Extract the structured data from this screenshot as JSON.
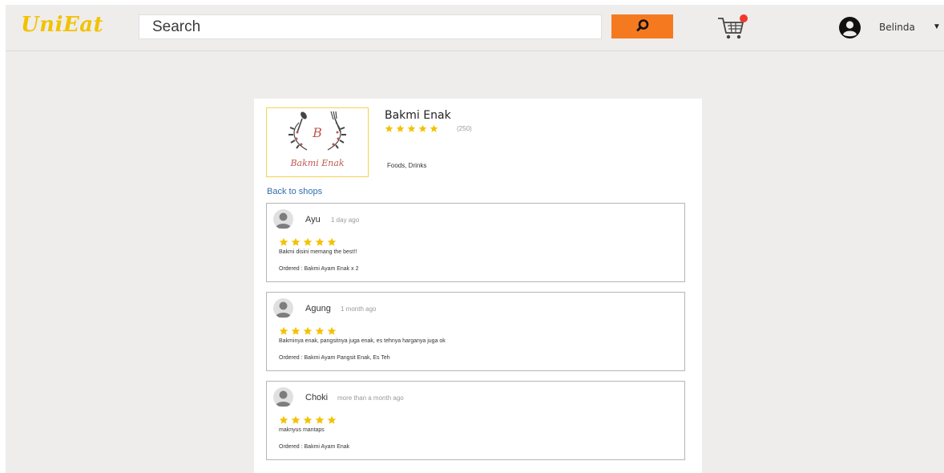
{
  "app": {
    "logo": "UniEat"
  },
  "search": {
    "placeholder": "Search"
  },
  "user": {
    "name": "Belinda"
  },
  "colors": {
    "accent": "#f57a1f",
    "logo": "#f2c200",
    "star": "#f2c200",
    "badge": "#f0382e",
    "link": "#2f6fae"
  },
  "icons": {
    "search": "search-icon",
    "cart": "cart-icon",
    "user": "user-avatar-icon",
    "caret": "caret-down-icon"
  },
  "shop": {
    "name": "Bakmi Enak",
    "rating": 5,
    "review_count": "(250)",
    "categories": "Foods, Drinks",
    "logo_letter": "B",
    "logo_text": "Bakmi Enak"
  },
  "back_link": "Back to shops",
  "reviews": [
    {
      "name": "Ayu",
      "time": "1 day ago",
      "rating": 5,
      "text": "Bakmi disini memang the best!!",
      "ordered": "Ordered : Bakmi Ayam Enak x 2"
    },
    {
      "name": "Agung",
      "time": "1 month ago",
      "rating": 5,
      "text": "Bakminya enak, pangsitnya juga enak, es tehnya harganya juga ok",
      "ordered": "Ordered : Bakmi Ayam Pangsit Enak, Es Teh"
    },
    {
      "name": "Choki",
      "time": "more than a month ago",
      "rating": 5,
      "text": "maknyus mantaps",
      "ordered": "Ordered : Bakmi Ayam Enak"
    }
  ]
}
